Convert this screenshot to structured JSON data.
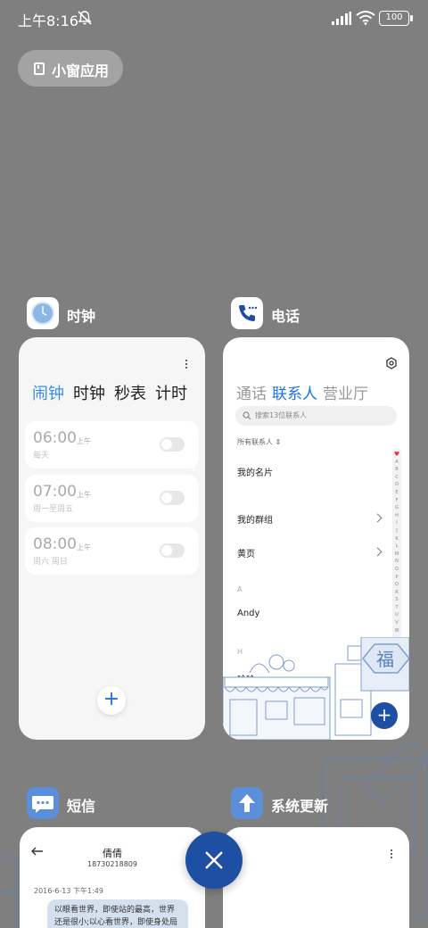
{
  "status_bar": {
    "time": "上午8:16",
    "battery": "100"
  },
  "floating_windows_label": "小窗应用",
  "clock": {
    "app_name": "时钟",
    "tabs": [
      {
        "label": "闹钟",
        "active": true
      },
      {
        "label": "时钟",
        "active": false
      },
      {
        "label": "秒表",
        "active": false
      },
      {
        "label": "计时",
        "active": false
      }
    ],
    "alarms": [
      {
        "time": "06:00",
        "ampm": "上午",
        "repeat": "每天",
        "enabled": false
      },
      {
        "time": "07:00",
        "ampm": "上午",
        "repeat": "周一至周五",
        "enabled": false
      },
      {
        "time": "08:00",
        "ampm": "上午",
        "repeat": "周六 周日",
        "enabled": false
      }
    ],
    "add_symbol": "+"
  },
  "phone": {
    "app_name": "电话",
    "tabs": [
      {
        "label": "通话",
        "active": false
      },
      {
        "label": "联系人",
        "active": true
      },
      {
        "label": "营业厅",
        "active": false
      }
    ],
    "search_placeholder": "搜索13位联系人",
    "filter_label": "所有联系人",
    "my_card": "我的名片",
    "my_groups": "我的群组",
    "yellow_pages": "黄页",
    "section_a": "A",
    "contact_1": "Andy",
    "section_h": "H",
    "contact_2": "哈哈",
    "alpha_index": [
      "A",
      "B",
      "C",
      "D",
      "E",
      "F",
      "G",
      "H",
      "I",
      "J",
      "K",
      "L",
      "M",
      "N",
      "O",
      "P",
      "Q",
      "R",
      "S",
      "T",
      "U",
      "V",
      "W"
    ],
    "banner_char": "福",
    "add_symbol": "+"
  },
  "sms": {
    "app_name": "短信",
    "contact_name": "倩倩",
    "contact_number": "18730218809",
    "date": "2016-6-13 下午1:49",
    "message": "以眼看世界，即使站的最高，世界还是很小;以心看世界，即使身处局限，"
  },
  "system_update": {
    "app_name": "系统更新"
  },
  "colors": {
    "accent": "#1a73e8",
    "fab_blue": "#1d4fa3",
    "background": "#7f7f7f"
  }
}
